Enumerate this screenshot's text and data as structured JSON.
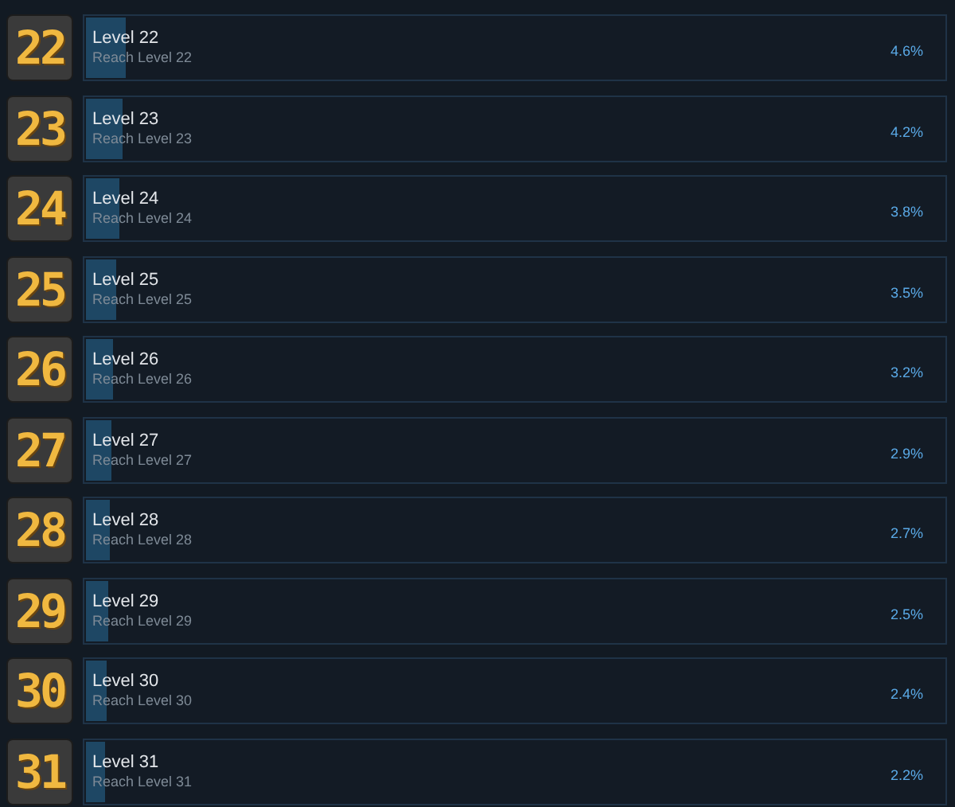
{
  "achievements": [
    {
      "badge": "22",
      "title": "Level 22",
      "description": "Reach Level 22",
      "percent": "4.6%",
      "level": 0.046
    },
    {
      "badge": "23",
      "title": "Level 23",
      "description": "Reach Level 23",
      "percent": "4.2%",
      "level": 0.042
    },
    {
      "badge": "24",
      "title": "Level 24",
      "description": "Reach Level 24",
      "percent": "3.8%",
      "level": 0.038
    },
    {
      "badge": "25",
      "title": "Level 25",
      "description": "Reach Level 25",
      "percent": "3.5%",
      "level": 0.035
    },
    {
      "badge": "26",
      "title": "Level 26",
      "description": "Reach Level 26",
      "percent": "3.2%",
      "level": 0.032
    },
    {
      "badge": "27",
      "title": "Level 27",
      "description": "Reach Level 27",
      "percent": "2.9%",
      "level": 0.029
    },
    {
      "badge": "28",
      "title": "Level 28",
      "description": "Reach Level 28",
      "percent": "2.7%",
      "level": 0.027
    },
    {
      "badge": "29",
      "title": "Level 29",
      "description": "Reach Level 29",
      "percent": "2.5%",
      "level": 0.025
    },
    {
      "badge": "30",
      "title": "Level 30",
      "description": "Reach Level 30",
      "percent": "2.4%",
      "level": 0.024
    },
    {
      "badge": "31",
      "title": "Level 31",
      "description": "Reach Level 31",
      "percent": "2.2%",
      "level": 0.022
    }
  ]
}
